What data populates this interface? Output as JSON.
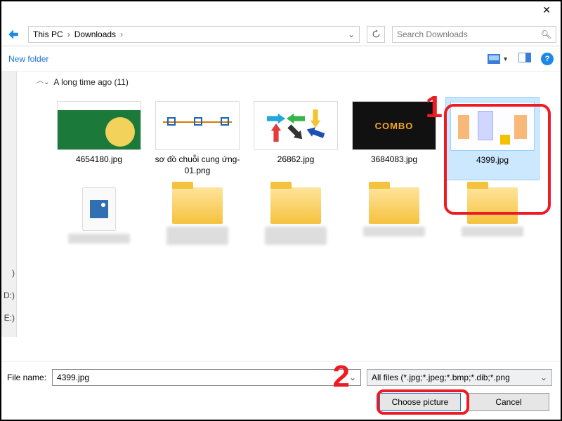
{
  "titlebar": {
    "close": "✕"
  },
  "nav": {
    "bc1": "This PC",
    "bc2": "Downloads",
    "search_placeholder": "Search Downloads"
  },
  "toolbar": {
    "newfolder": "New folder",
    "help": "?"
  },
  "group": {
    "label": "A long time ago (11)"
  },
  "files": [
    {
      "name": "4654180.jpg"
    },
    {
      "name": "sơ đồ chuỗi cung ứng-01.png"
    },
    {
      "name": "26862.jpg"
    },
    {
      "name": "3684083.jpg"
    },
    {
      "name": "4399.jpg"
    }
  ],
  "sidebar": {
    "it1": ")",
    "it2": "D:)",
    "it3": "E:)"
  },
  "footer": {
    "label": "File name:",
    "value": "4399.jpg",
    "filter": "All files (*.jpg;*.jpeg;*.bmp;*.dib;*.png",
    "choose": "Choose picture",
    "cancel": "Cancel"
  },
  "annot": {
    "one": "1",
    "two": "2"
  },
  "combo": "COMBO"
}
